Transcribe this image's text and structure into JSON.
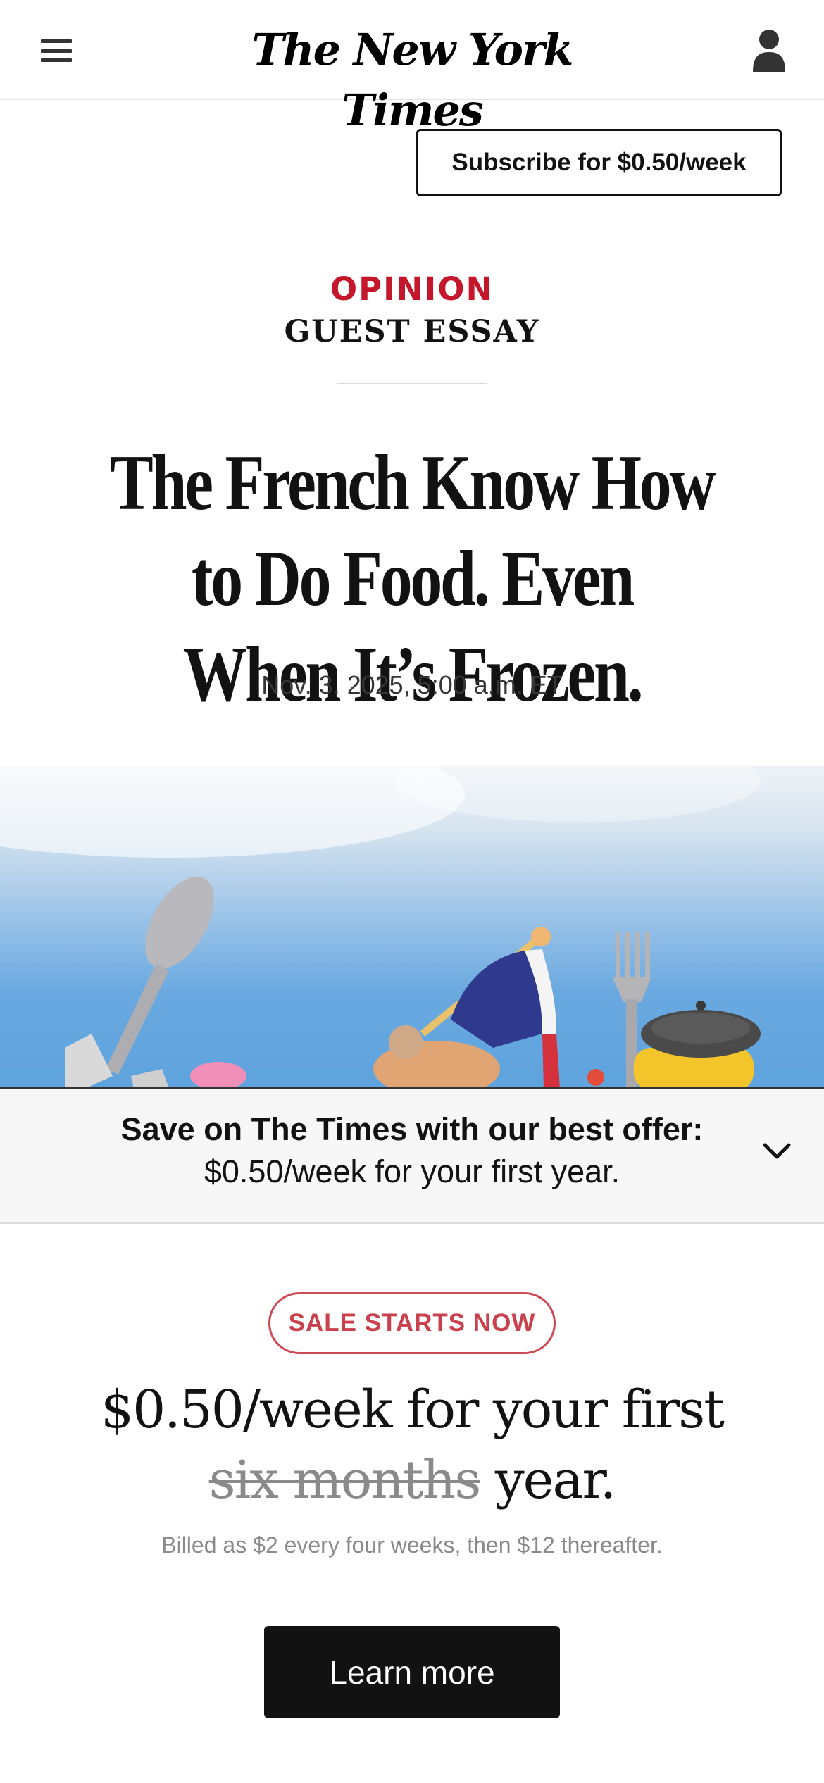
{
  "masthead": {
    "logo_text": "The New York Times",
    "menu_icon": "hamburger-menu-icon",
    "account_icon": "user-account-icon"
  },
  "subscribe": {
    "label": "Subscribe for $0.50/week"
  },
  "article": {
    "section": "OPINION",
    "column": "GUEST ESSAY",
    "headline": "The French Know How to Do Food. Even When It’s Frozen.",
    "dateline": "Nov. 3, 2025, 5:00 a.m. ET"
  },
  "offer_bar": {
    "line1": "Save on The Times with our best offer:",
    "line2": "$0.50/week for your first year.",
    "toggle_icon": "chevron-down-icon"
  },
  "promo": {
    "badge": "SALE STARTS NOW",
    "headline_main": "$0.50/week for your first",
    "headline_struck": "six months",
    "headline_end": "year.",
    "billing": "Billed as $2 every four weeks, then $12 thereafter.",
    "cta": "Learn more"
  },
  "colors": {
    "opinion_red": "#c4172c",
    "sale_red": "#c8414c",
    "cta_black": "#121212",
    "sky_blue": "#6aa9e0"
  }
}
